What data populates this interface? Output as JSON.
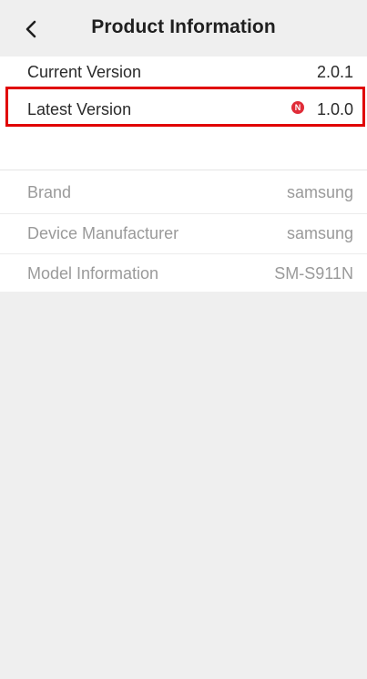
{
  "header": {
    "title": "Product Information",
    "back_icon": "chevron-left-icon"
  },
  "version": {
    "current_label": "Current Version",
    "current_value": "2.0.1",
    "latest_label": "Latest Version",
    "latest_value": "1.0.0",
    "new_badge": "N",
    "badge_color": "#e02c38",
    "highlight_color": "#e00000"
  },
  "device_info": {
    "rows": [
      {
        "label": "Brand",
        "value": "samsung"
      },
      {
        "label": "Device Manufacturer",
        "value": "samsung"
      },
      {
        "label": "Model Information",
        "value": "SM-S911N"
      }
    ]
  }
}
